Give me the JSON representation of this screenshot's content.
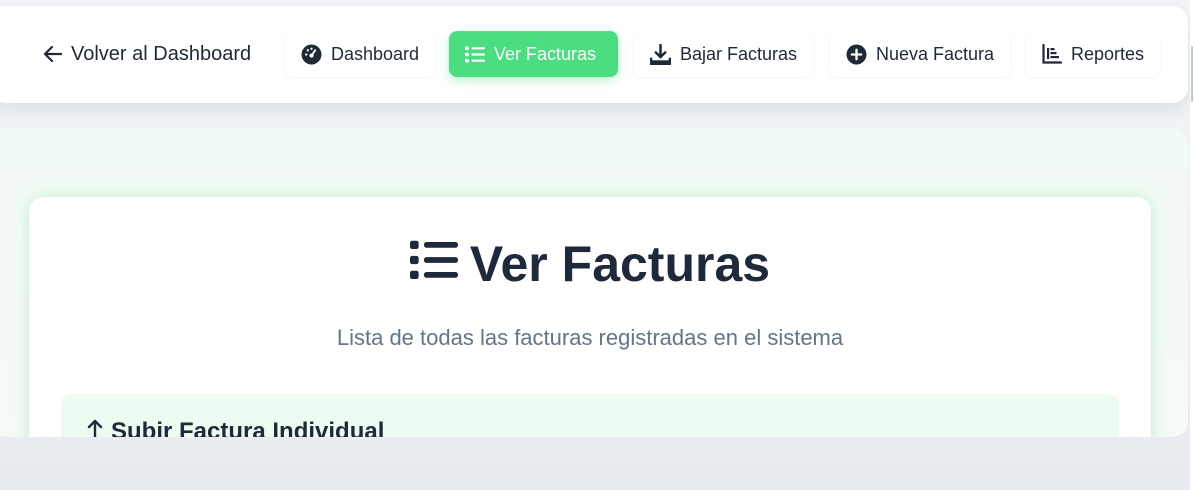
{
  "nav": {
    "back_label": "Volver al Dashboard",
    "items": [
      {
        "label": "Dashboard",
        "icon": "dashboard-gauge-icon"
      },
      {
        "label": "Ver Facturas",
        "icon": "list-icon",
        "active": true
      },
      {
        "label": "Bajar Facturas",
        "icon": "download-icon"
      },
      {
        "label": "Nueva Factura",
        "icon": "plus-circle-icon"
      },
      {
        "label": "Reportes",
        "icon": "bar-chart-icon"
      }
    ]
  },
  "main": {
    "title": "Ver Facturas",
    "title_icon": "list-icon",
    "subtitle": "Lista de todas las facturas registradas en el sistema",
    "upload_section": {
      "title": "Subir Factura Individual",
      "icon": "arrow-up-icon"
    }
  },
  "colors": {
    "accent": "#4ade80",
    "text_dark": "#1e293b",
    "text_muted": "#64748b",
    "panel_tint": "#edfbf1"
  }
}
